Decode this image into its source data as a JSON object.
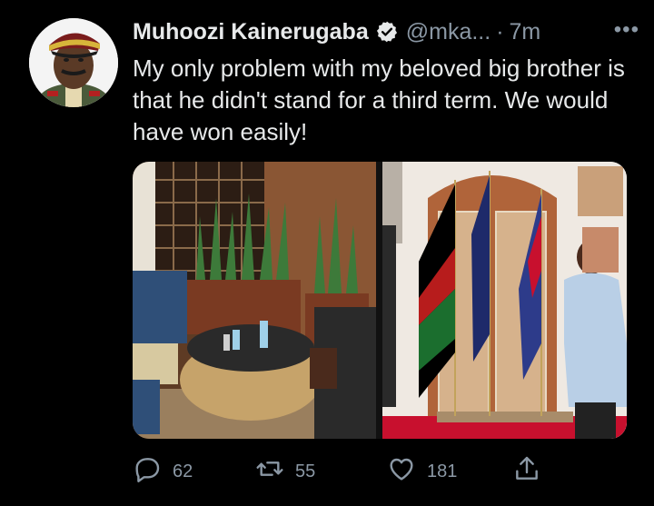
{
  "tweet": {
    "author_name": "Muhoozi Kainerugaba",
    "handle": "@mka...",
    "separator": "·",
    "time": "7m",
    "more_label": "•••",
    "text": "My only problem with my beloved big brother is that he didn't stand for a third term. We would have won easily!"
  },
  "actions": {
    "reply_count": "62",
    "retweet_count": "55",
    "like_count": "181"
  },
  "icons": {
    "verified": "verified-badge-icon",
    "reply": "reply-icon",
    "retweet": "retweet-icon",
    "like": "heart-icon",
    "share": "share-icon"
  },
  "colors": {
    "background": "#000000",
    "text": "#e7e9ea",
    "muted": "#8b98a5"
  }
}
